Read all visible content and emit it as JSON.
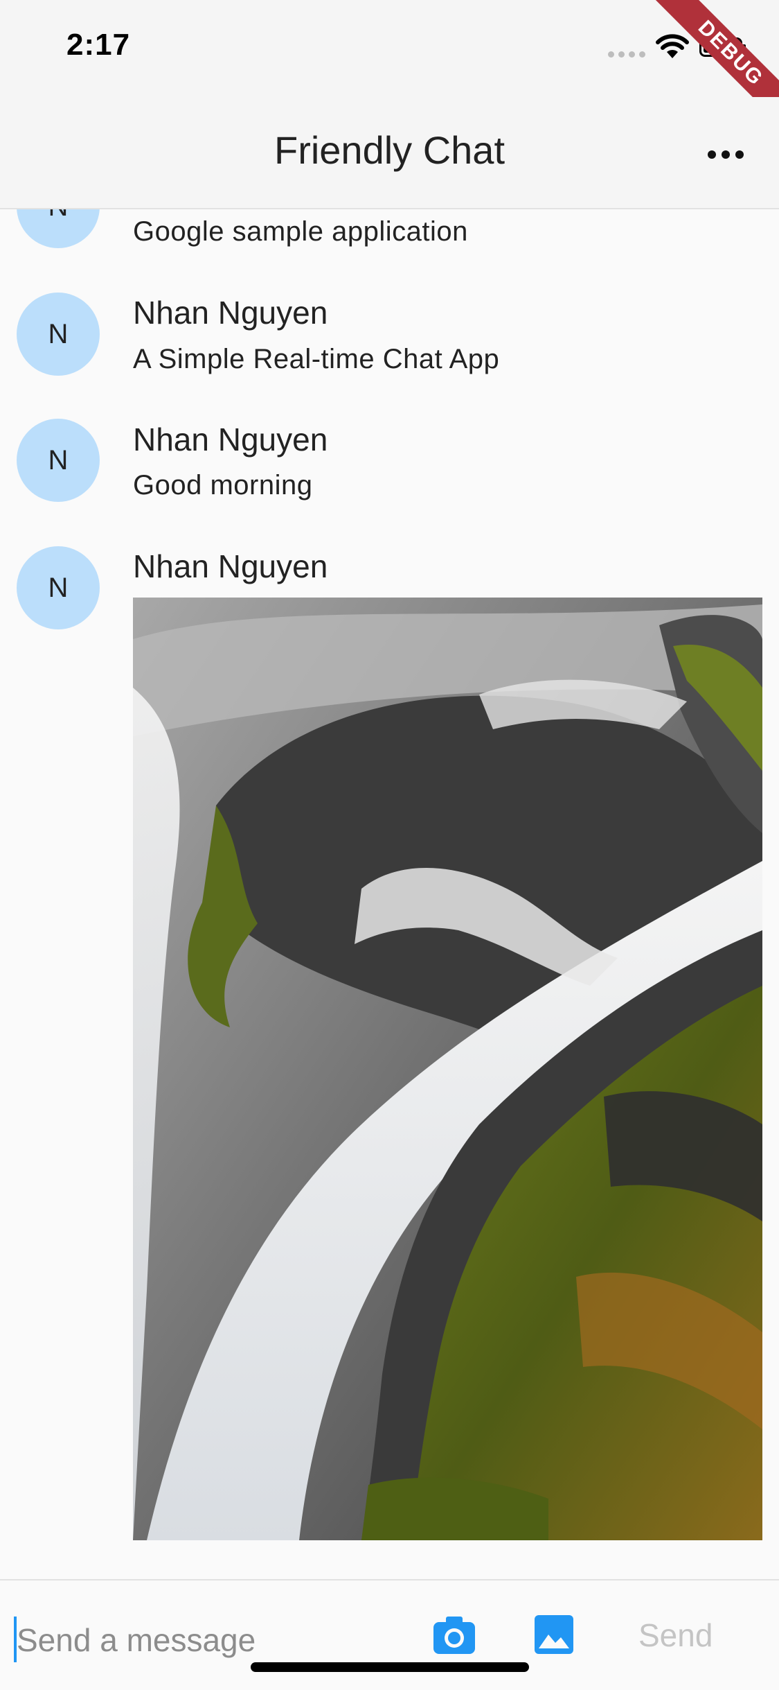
{
  "status_bar": {
    "time": "2:17",
    "debug_banner": "DEBUG"
  },
  "app_bar": {
    "title": "Friendly Chat",
    "menu_icon": "more-horizontal-icon"
  },
  "messages": [
    {
      "avatar": "N",
      "sender": "",
      "text": "Google sample application"
    },
    {
      "avatar": "N",
      "sender": "Nhan Nguyen",
      "text": "A Simple Real-time Chat App"
    },
    {
      "avatar": "N",
      "sender": "Nhan Nguyen",
      "text": "Good morning"
    },
    {
      "avatar": "N",
      "sender": "Nhan Nguyen",
      "image": "waterfall-mossy-rocks-photo"
    }
  ],
  "composer": {
    "placeholder": "Send a message",
    "value": "",
    "camera_icon": "camera-icon",
    "gallery_icon": "image-icon",
    "send_label": "Send"
  },
  "colors": {
    "accent": "#2196f3",
    "avatar_bg": "#bbdefb",
    "debug_banner": "#b0313a",
    "send_disabled": "#c4c4c4"
  }
}
